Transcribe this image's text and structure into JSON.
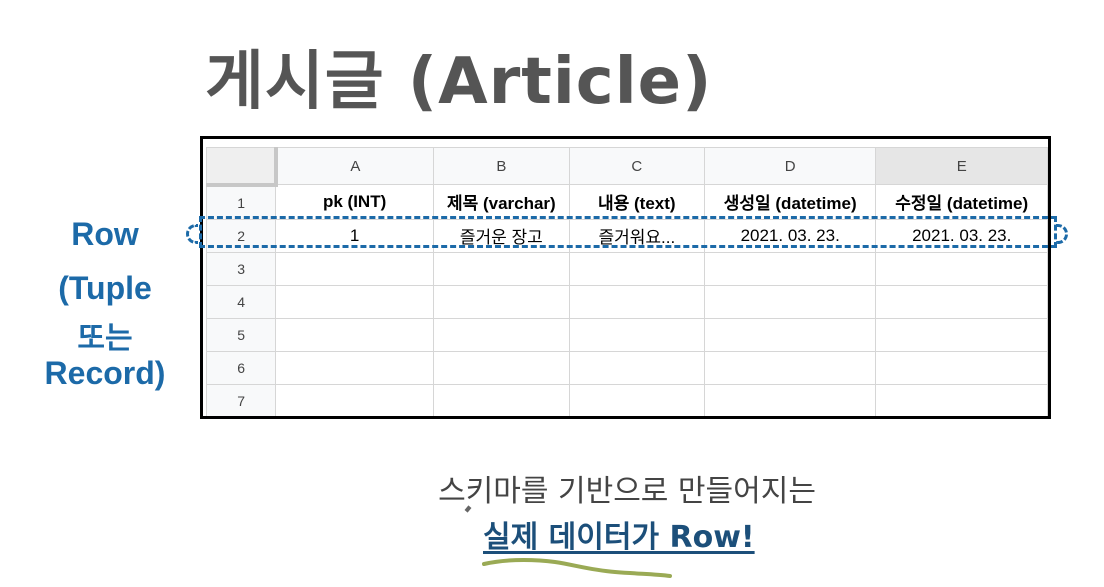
{
  "title": "게시글 (Article)",
  "sheet": {
    "columns": [
      "A",
      "B",
      "C",
      "D",
      "E"
    ],
    "rows": [
      {
        "num": "1",
        "cells": [
          "pk (INT)",
          "제목 (varchar)",
          "내용 (text)",
          "생성일 (datetime)",
          "수정일 (datetime)"
        ]
      },
      {
        "num": "2",
        "cells": [
          "1",
          "즐거운 장고",
          "즐거워요...",
          "2021. 03. 23.",
          "2021. 03. 23."
        ]
      },
      {
        "num": "3",
        "cells": [
          "",
          "",
          "",
          "",
          ""
        ]
      },
      {
        "num": "4",
        "cells": [
          "",
          "",
          "",
          "",
          ""
        ]
      },
      {
        "num": "5",
        "cells": [
          "",
          "",
          "",
          "",
          ""
        ]
      },
      {
        "num": "6",
        "cells": [
          "",
          "",
          "",
          "",
          ""
        ]
      },
      {
        "num": "7",
        "cells": [
          "",
          "",
          "",
          "",
          ""
        ]
      }
    ]
  },
  "side_label": {
    "line1": "Row",
    "line2": "(Tuple",
    "line3": "또는",
    "line4": "Record)"
  },
  "caption": {
    "line1": "스키마를 기반으로 만들어지는",
    "line2": "실제 데이터가 Row!"
  },
  "colors": {
    "accent": "#1c6aa8",
    "caption_emphasis": "#1c4f7a",
    "title": "#555555",
    "squiggle": "#9aaa55"
  }
}
